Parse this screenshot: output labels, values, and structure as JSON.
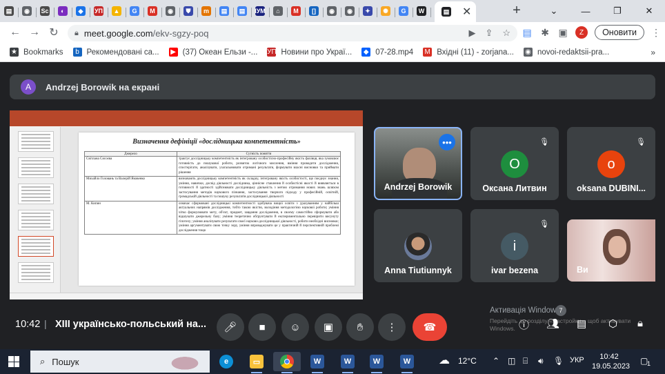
{
  "browser": {
    "tabs": [
      {
        "icon": "doc-icon",
        "color": "#4a4a4a",
        "glyph": "▤"
      },
      {
        "icon": "chrome-settings-icon",
        "color": "#5f6368",
        "glyph": "◉"
      },
      {
        "icon": "sc-icon",
        "color": "#4a4a4a",
        "glyph": "Sc"
      },
      {
        "icon": "opera-icon",
        "color": "#7b2cbf",
        "glyph": "◐"
      },
      {
        "icon": "diamond-icon",
        "color": "#1a73e8",
        "glyph": "◆"
      },
      {
        "icon": "up-icon",
        "color": "#c62828",
        "glyph": "УП"
      },
      {
        "icon": "drive-icon",
        "color": "#f4b400",
        "glyph": "▲"
      },
      {
        "icon": "google-icon",
        "color": "#4285f4",
        "glyph": "G"
      },
      {
        "icon": "gmail-icon",
        "color": "#d93025",
        "glyph": "M"
      },
      {
        "icon": "globe-icon",
        "color": "#5f6368",
        "glyph": "◉"
      },
      {
        "icon": "shield-icon",
        "color": "#3949ab",
        "glyph": "⛊"
      },
      {
        "icon": "m-icon",
        "color": "#e37400",
        "glyph": "m"
      },
      {
        "icon": "docs-icon",
        "color": "#4285f4",
        "glyph": "▤"
      },
      {
        "icon": "docs-icon",
        "color": "#4285f4",
        "glyph": "▤"
      },
      {
        "icon": "iym-icon",
        "color": "#1a237e",
        "glyph": "IУМ"
      },
      {
        "icon": "building-icon",
        "color": "#5f6368",
        "glyph": "⌂"
      },
      {
        "icon": "gmail-icon",
        "color": "#d93025",
        "glyph": "M"
      },
      {
        "icon": "bracket-icon",
        "color": "#1565c0",
        "glyph": "[]"
      },
      {
        "icon": "globe-icon",
        "color": "#5f6368",
        "glyph": "◉"
      },
      {
        "icon": "globe-icon",
        "color": "#5f6368",
        "glyph": "◉"
      },
      {
        "icon": "crest-icon",
        "color": "#3949ab",
        "glyph": "✦"
      },
      {
        "icon": "sparkle-icon",
        "color": "#f9a825",
        "glyph": "✺"
      },
      {
        "icon": "google-icon",
        "color": "#4285f4",
        "glyph": "G"
      },
      {
        "icon": "wikipedia-icon",
        "color": "#202124",
        "glyph": "W"
      }
    ],
    "new_tab": "+",
    "window_controls": {
      "minimize": "⌄",
      "restore": "—",
      "maximize": "❐",
      "close": "✕"
    },
    "url_host": "meet.google.com",
    "url_path": "/ekv-sgzy-poq",
    "profile_initial": "Z",
    "update_label": "Оновити",
    "bookmarks": [
      {
        "icon": "star-icon",
        "glyph": "★",
        "color": "#3c4043",
        "label": "Bookmarks"
      },
      {
        "icon": "b-icon",
        "glyph": "b",
        "color": "#1565c0",
        "label": "Рекомендовані са..."
      },
      {
        "icon": "youtube-icon",
        "glyph": "▶",
        "color": "#ff0000",
        "label": "(37) Океан Ельзи -..."
      },
      {
        "icon": "up-icon",
        "glyph": "УП",
        "color": "#c62828",
        "label": "Новини про Украї..."
      },
      {
        "icon": "dropbox-icon",
        "glyph": "◆",
        "color": "#0061fe",
        "label": "07-28.mp4"
      },
      {
        "icon": "gmail-icon",
        "glyph": "M",
        "color": "#d93025",
        "label": "Вхідні (11) - zorjana..."
      },
      {
        "icon": "globe-icon",
        "glyph": "◉",
        "color": "#5f6368",
        "label": "novoi-redaktsii-pra..."
      }
    ],
    "bookmarks_more": "»"
  },
  "meet": {
    "presenter_initial": "A",
    "presenter_banner": "Andrzej Borowik на екрані",
    "presentation": {
      "slide_title": "Визначення дефініції «дослідницька компетентність»",
      "col_source": "Джерело",
      "col_essence": "Сутність поняття",
      "rows": [
        {
          "source": "Світлана Сисоєва",
          "definition": "трактує дослідницьку компетентність як інтегровану особистісно-професійну якість фахівця, яка зумовлює готовність до пошукової роботи, розвиток логічного мислення, вміння проводити дослідження, спостерігати, аналізувати, узагальнювати отримані результати, формувати власні висновки та приймати рішення"
        },
        {
          "source": "Михайло Головань та Валерій Яковенко",
          "definition": "визначають дослідницьку компетентність як складну, інтегровану якість особистості, що поєднує знання, уміння, навички, досвід діяльності дослідника, ціннісне ставлення й особистісні якості й виявляється в готовності й здатності здійснювати дослідницьку діяльність з метою отримання нових знань шляхом застосування методів наукового пізнання, застосування творчого підходу у професійній, освітній, громадській діяльності та пошуку результатів дослідницької діяльності"
        },
        {
          "source": "М. Кипин",
          "definition": "означає сформовані дослідницькі компетентності здобувача вищої освіти з урахуванням у найбільш актуальних напрямів дослідження, тобто такою якістю, володіння методологією наукової роботи; уміння чітко формулювати мету, об'єкт, предмет, завдання дослідження, в своєму самостійно сформувати або відшукати джерельну базу; уміння теоретично обґрунтувати й експериментально перевірити висунуту гіпотезу; уміння аналізувати результати своєї науково-дослідницької діяльності, робити необхідні висновки; уміння аргументувати свою точку зору, уміння впроваджувати це у практичній й перспективній проблемі дослідження тощо"
        }
      ]
    },
    "participants": [
      {
        "name": "Andrzej Borowik",
        "initial": "",
        "color": "#3c4043"
      },
      {
        "name": "Оксана Литвин",
        "initial": "О",
        "color": "#1e8e3e"
      },
      {
        "name": "oksana DUBINI...",
        "initial": "o",
        "color": "#e8430d"
      },
      {
        "name": "Anna Tiutiunnyk",
        "initial": "",
        "color": "#3c4043"
      },
      {
        "name": "ivar bezena",
        "initial": "i",
        "color": "#455a64"
      },
      {
        "name": "Ви",
        "initial": "",
        "color": "#3c4043"
      }
    ],
    "time": "10:42",
    "divider": "|",
    "meeting_title": "XIII українсько-польський на...",
    "activation_title": "Активація Windows",
    "activation_sub": "Перейдіть до розділу «Настройки», щоб активувати Windows.",
    "activation_badge": "7"
  },
  "taskbar": {
    "search_placeholder": "Пошук",
    "weather": "12°C",
    "language": "УКР",
    "time": "10:42",
    "date": "19.05.2023",
    "notification_count": "1"
  }
}
